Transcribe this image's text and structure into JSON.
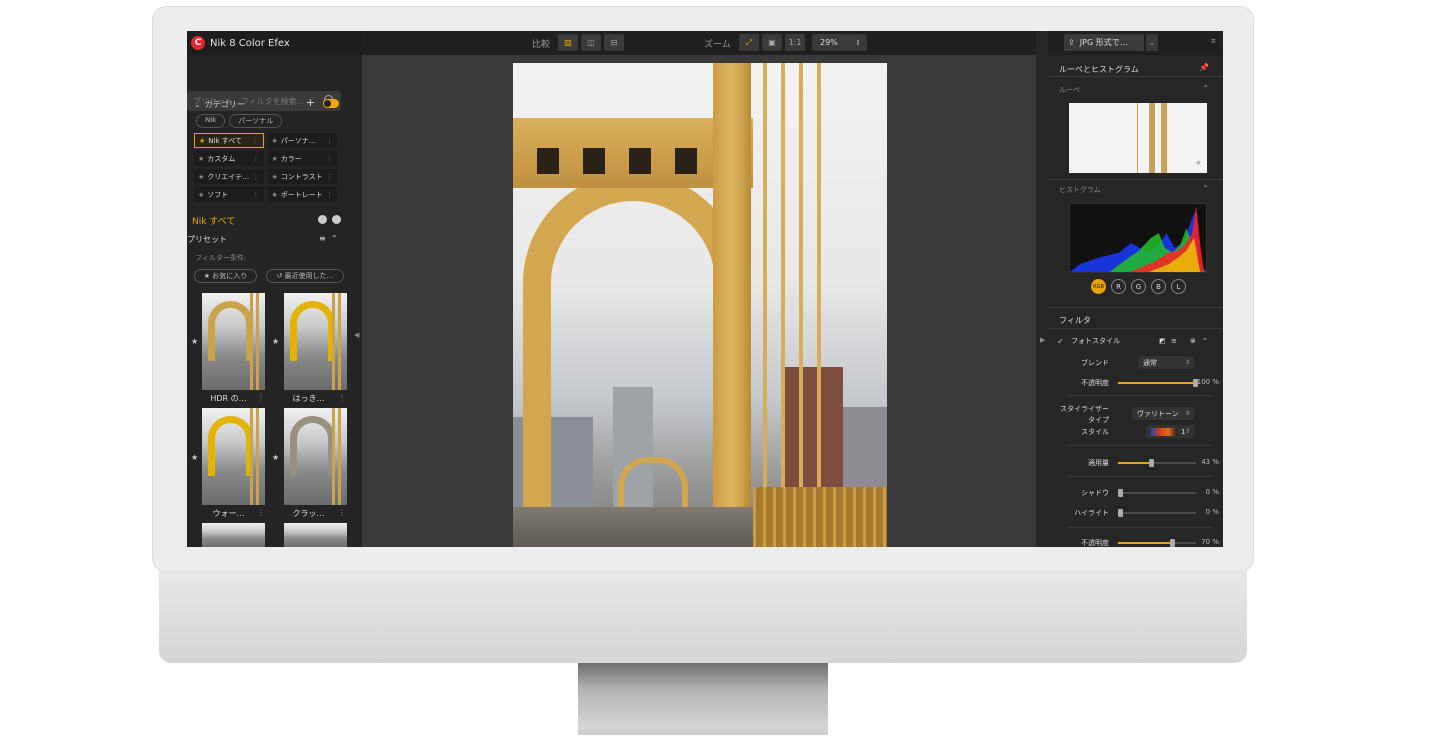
{
  "app": {
    "title": "Nik 8 Color Efex",
    "logo_letter": "C"
  },
  "search": {
    "placeholder": "プリセット、フィルタを検索..."
  },
  "categories": {
    "header": "カテゴリー",
    "plus": "+",
    "chips": [
      "Nik",
      "パーソナル"
    ],
    "items": [
      {
        "label": "Nik すべて",
        "active": true
      },
      {
        "label": "パーソナ…",
        "active": false
      },
      {
        "label": "カスタム",
        "active": false
      },
      {
        "label": "カラー",
        "active": false
      },
      {
        "label": "クリエイテ…",
        "active": false
      },
      {
        "label": "コントラスト",
        "active": false
      },
      {
        "label": "ソフト",
        "active": false
      },
      {
        "label": "ポートレート",
        "active": false
      }
    ]
  },
  "nik_all": {
    "label": "Nik すべて"
  },
  "presets": {
    "header": "プリセット",
    "filter_label": "フィルター条件:",
    "favorites": "お気に入り",
    "recent": "最近使用した…",
    "thumbs": [
      {
        "label": "HDR の…",
        "style": "normal"
      },
      {
        "label": "はっき…",
        "style": "warm"
      },
      {
        "label": "ウォー…",
        "style": "warm"
      },
      {
        "label": "クラッ…",
        "style": "clas"
      }
    ]
  },
  "toolbar": {
    "compare_label": "比較",
    "zoom_label": "ズーム",
    "one_to_one": "1:1",
    "zoom_value": "29%"
  },
  "export": {
    "label": "JPG 形式で…"
  },
  "panels": {
    "loupe_histogram": "ルーペとヒストグラム",
    "loupe": "ルーペ",
    "histogram": "ヒストグラム",
    "channels": [
      "RGB",
      "R",
      "G",
      "B",
      "L"
    ],
    "filters": "フィルタ"
  },
  "filter": {
    "name": "フォトスタイル",
    "blend_label": "ブレンド",
    "blend_value": "通常",
    "opacity_label": "不透明度",
    "opacity_value": "100 %",
    "opacity_level": 1.0,
    "stylizer_label": "スタイライザー",
    "type_label": "タイプ",
    "type_value": "ヴァリトーン",
    "style_label": "スタイル",
    "style_value": "1",
    "amount_label": "適用量",
    "amount_value": "43 %",
    "amount_level": 0.43,
    "shadow_label": "シャドウ",
    "shadow_value": "0 %",
    "shadow_level": 0,
    "highlight_label": "ハイライト",
    "highlight_value": "0 %",
    "highlight_level": 0,
    "opacity2_label": "不透明度",
    "opacity2_value": "70 %",
    "opacity2_level": 0.7
  },
  "colors": {
    "accent": "#e8a300",
    "logo": "#e3252f"
  }
}
